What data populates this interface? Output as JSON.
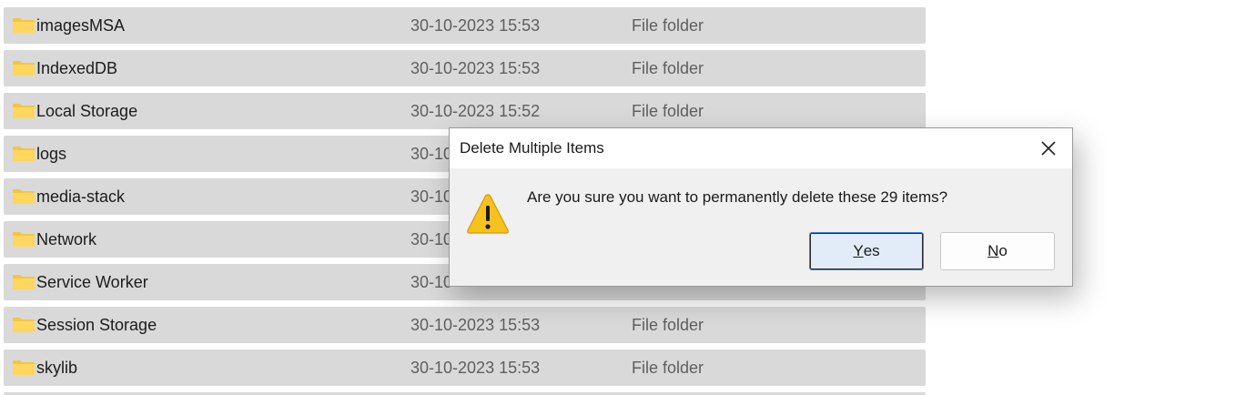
{
  "file_list": {
    "rows": [
      {
        "name": "imagesMSA",
        "date": "30-10-2023 15:53",
        "type": "File folder"
      },
      {
        "name": "IndexedDB",
        "date": "30-10-2023 15:53",
        "type": "File folder"
      },
      {
        "name": "Local Storage",
        "date": "30-10-2023 15:52",
        "type": "File folder"
      },
      {
        "name": "logs",
        "date": "30-10",
        "type": ""
      },
      {
        "name": "media-stack",
        "date": "30-10",
        "type": ""
      },
      {
        "name": "Network",
        "date": "30-10",
        "type": ""
      },
      {
        "name": "Service Worker",
        "date": "30-10",
        "type": ""
      },
      {
        "name": "Session Storage",
        "date": "30-10-2023 15:53",
        "type": "File folder"
      },
      {
        "name": "skylib",
        "date": "30-10-2023 15:53",
        "type": "File folder"
      }
    ],
    "folder_icon": "folder-icon",
    "colors": {
      "row_bg": "#d9d9d9",
      "folder": "#ffd75e"
    }
  },
  "dialog": {
    "title": "Delete Multiple Items",
    "message": "Are you sure you want to permanently delete these 29 items?",
    "close_icon": "close-icon",
    "warning_icon": "warning-icon",
    "yes": {
      "accel": "Y",
      "rest": "es"
    },
    "no": {
      "accel": "N",
      "rest": "o"
    },
    "colors": {
      "default_button": "#e1ecf8",
      "focus_border": "#3c7dd6",
      "warning": "#f7c11e"
    }
  }
}
